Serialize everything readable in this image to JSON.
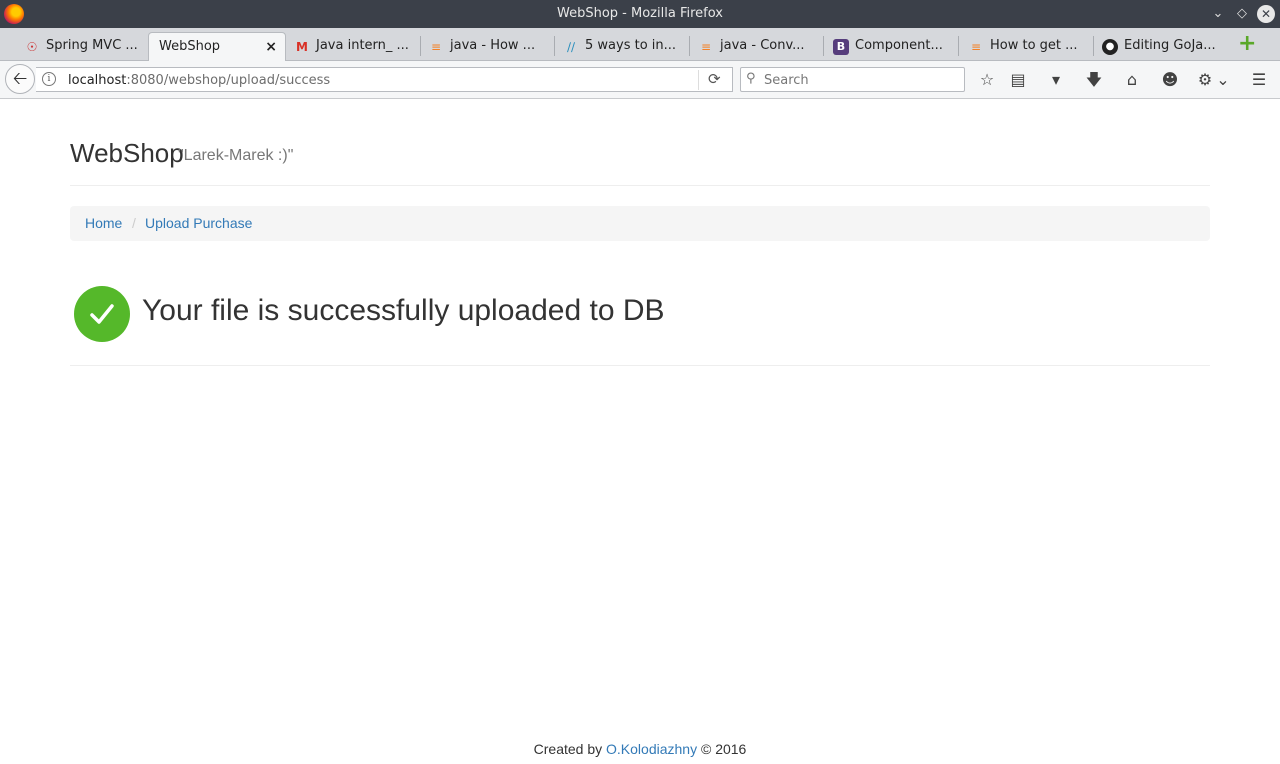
{
  "window": {
    "title": "WebShop - Mozilla Firefox"
  },
  "tabs": [
    {
      "label": "Spring MVC ...",
      "icon": "spring-icon"
    },
    {
      "label": "WebShop",
      "icon": "",
      "active": true
    },
    {
      "label": "Java intern_ ...",
      "icon": "gmail-icon"
    },
    {
      "label": "java - How ...",
      "icon": "stackoverflow-icon"
    },
    {
      "label": "5 ways to in...",
      "icon": "stripes-icon"
    },
    {
      "label": "java - Conv...",
      "icon": "stackoverflow-icon"
    },
    {
      "label": "Component...",
      "icon": "bootstrap-icon"
    },
    {
      "label": "How to get ...",
      "icon": "stackoverflow-icon"
    },
    {
      "label": "Editing GoJa...",
      "icon": "github-icon"
    }
  ],
  "navbar": {
    "url_host": "localhost",
    "url_rest": ":8080/webshop/upload/success",
    "search_placeholder": "Search"
  },
  "page": {
    "brand": "WebShop",
    "brand_sub": "\"Larek-Marek :)\"",
    "breadcrumb": {
      "home": "Home",
      "current": "Upload Purchase",
      "separator": "/"
    },
    "success_message": "Your file is successfully uploaded to DB",
    "footer": {
      "prefix": "Created by",
      "author": "O.Kolodiazhny",
      "suffix": "© 2016"
    }
  },
  "colors": {
    "success": "#55b82a",
    "link": "#337ab7"
  }
}
